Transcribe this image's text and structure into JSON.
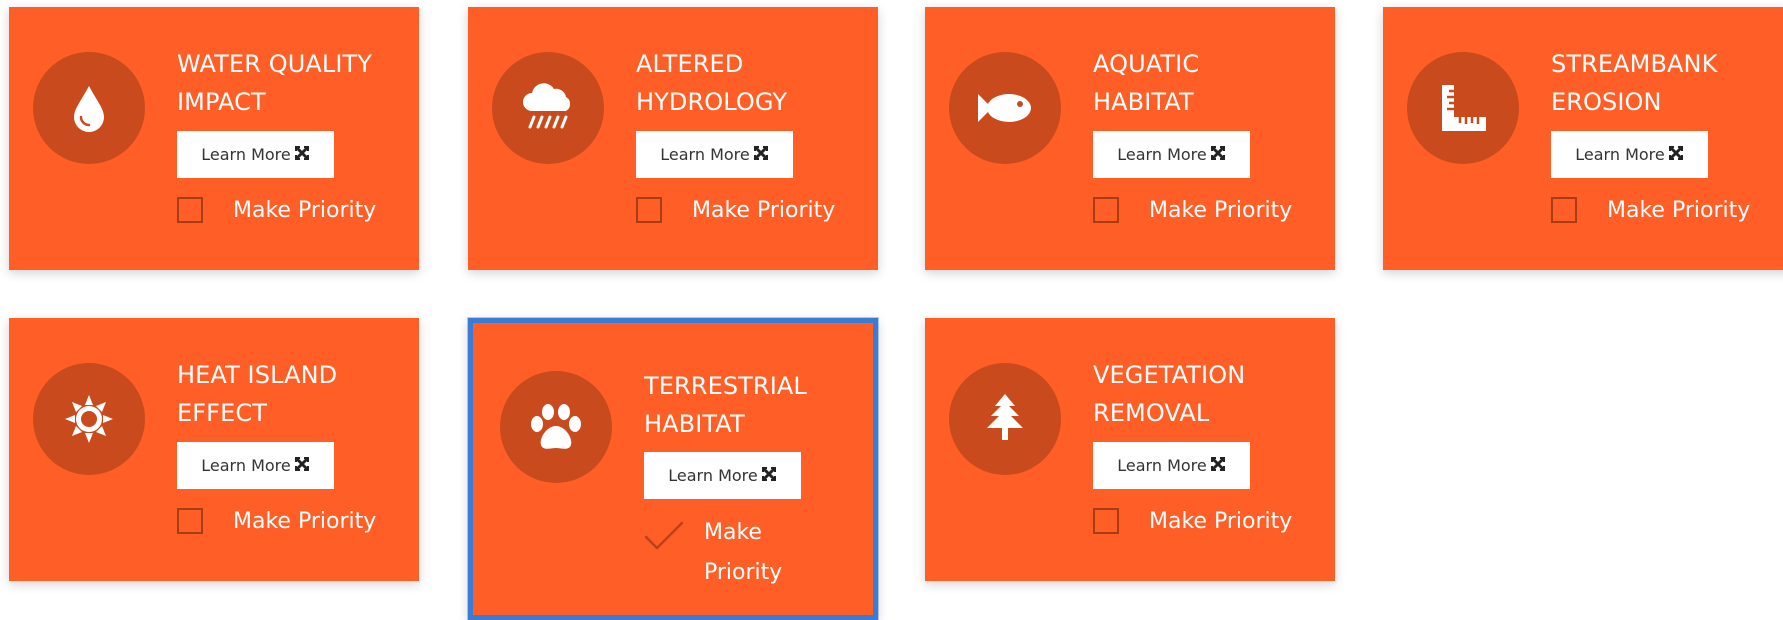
{
  "cards": [
    {
      "title_line1": "WATER QUALITY",
      "title_line2": "IMPACT",
      "learn_more": "Learn More",
      "priority": "Make Priority",
      "icon": "water-drop-icon",
      "checked": false
    },
    {
      "title_line1": "ALTERED",
      "title_line2": "HYDROLOGY",
      "learn_more": "Learn More",
      "priority": "Make Priority",
      "icon": "rain-cloud-icon",
      "checked": false
    },
    {
      "title_line1": "AQUATIC",
      "title_line2": "HABITAT",
      "learn_more": "Learn More",
      "priority": "Make Priority",
      "icon": "fish-icon",
      "checked": false
    },
    {
      "title_line1": "STREAMBANK",
      "title_line2": "EROSION",
      "learn_more": "Learn More",
      "priority": "Make Priority",
      "icon": "ruler-icon",
      "checked": false
    },
    {
      "title_line1": "HEAT ISLAND",
      "title_line2": "EFFECT",
      "learn_more": "Learn More",
      "priority": "Make Priority",
      "icon": "sun-icon",
      "checked": false
    },
    {
      "title_line1": "TERRESTRIAL",
      "title_line2": "HABITAT",
      "learn_more": "Learn More",
      "priority": "Make Priority",
      "icon": "paw-icon",
      "checked": true
    },
    {
      "title_line1": "VEGETATION",
      "title_line2": "REMOVAL",
      "learn_more": "Learn More",
      "priority": "Make Priority",
      "icon": "tree-icon",
      "checked": false
    }
  ],
  "colors": {
    "card": "#ff5f26",
    "icon_circle": "#c94a1c",
    "selected_border": "#3a7bd5"
  }
}
